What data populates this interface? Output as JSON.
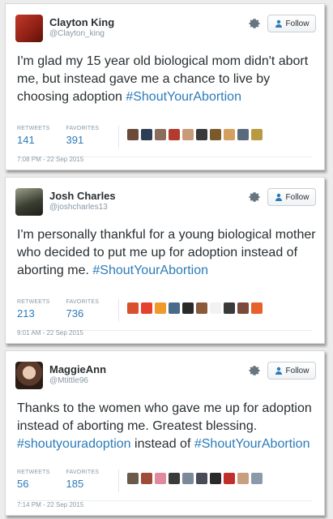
{
  "tweets": [
    {
      "name": "Clayton King",
      "handle": "@Clayton_king",
      "follow_label": "Follow",
      "text_plain": "I'm glad my 15 year old biological mom didn't abort me, but instead gave me a chance to live by choosing adoption ",
      "hashtag": "#ShoutYourAbortion",
      "text_after": "",
      "retweets_label": "RETWEETS",
      "retweets": "141",
      "favorites_label": "FAVORITES",
      "favorites": "391",
      "timestamp": "7:08 PM - 22 Sep 2015",
      "face_colors": [
        "#6b4a3a",
        "#2d3e55",
        "#8a6d5a",
        "#b23a2e",
        "#c99a7a",
        "#3a3a3a",
        "#7a5a2a",
        "#d4a060",
        "#5a6a7a",
        "#b89a40"
      ]
    },
    {
      "name": "Josh Charles",
      "handle": "@joshcharles13",
      "follow_label": "Follow",
      "text_plain": "I'm personally thankful for a young biological mother who decided to put me up for adoption instead of aborting me. ",
      "hashtag": "#ShoutYourAbortion",
      "text_after": "",
      "retweets_label": "RETWEETS",
      "retweets": "213",
      "favorites_label": "FAVORITES",
      "favorites": "736",
      "timestamp": "9:01 AM - 22 Sep 2015",
      "face_colors": [
        "#d9502e",
        "#e6412f",
        "#f09a2a",
        "#4a6a8a",
        "#2a2a2a",
        "#8a5a3a",
        "#f2f2f2",
        "#3a3a3a",
        "#7a4a3a",
        "#e8602a"
      ]
    },
    {
      "name": "MaggieAnn",
      "handle": "@Mtittle96",
      "follow_label": "Follow",
      "text_plain": "Thanks to the women who gave me up for adoption instead of aborting me. Greatest blessing. ",
      "hashtag": "#shoutyouradoption",
      "text_mid": " instead of ",
      "hashtag2": "#ShoutYourAbortion",
      "retweets_label": "RETWEETS",
      "retweets": "56",
      "favorites_label": "FAVORITES",
      "favorites": "185",
      "timestamp": "7:14 PM - 22 Sep 2015",
      "face_colors": [
        "#6a5a4a",
        "#a04a3a",
        "#e08aa0",
        "#3a3a3a",
        "#7a8a9a",
        "#4a4a5a",
        "#2a2a2a",
        "#c0302a",
        "#c8a080",
        "#8a9aaa"
      ]
    }
  ],
  "icons": {
    "gear": "gear-icon",
    "follow": "person-add-icon"
  },
  "colors": {
    "link": "#2b7bb9",
    "muted": "#8899a6",
    "text": "#292f33"
  }
}
